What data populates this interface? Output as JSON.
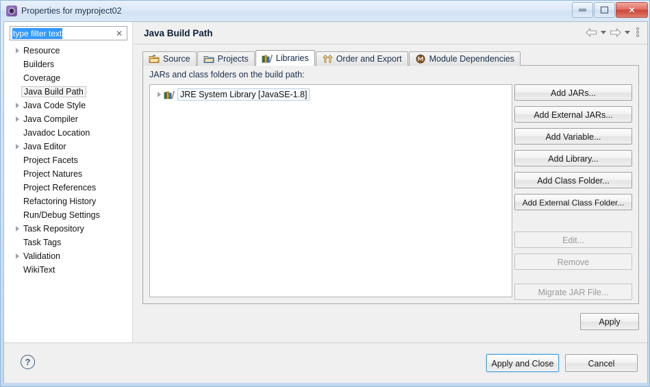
{
  "window": {
    "title": "Properties for myproject02",
    "app_icon": "eclipse-gear-icon",
    "minimize_label": "Minimize",
    "restore_label": "Restore",
    "close_label": "Close",
    "close_glyph": "✕"
  },
  "sidebar": {
    "filter": {
      "value": "type filter text",
      "placeholder": "type filter text",
      "clear_glyph": "✕"
    },
    "items": [
      {
        "label": "Resource",
        "expandable": true,
        "selected": false
      },
      {
        "label": "Builders",
        "expandable": false,
        "selected": false
      },
      {
        "label": "Coverage",
        "expandable": false,
        "selected": false
      },
      {
        "label": "Java Build Path",
        "expandable": false,
        "selected": true
      },
      {
        "label": "Java Code Style",
        "expandable": true,
        "selected": false
      },
      {
        "label": "Java Compiler",
        "expandable": true,
        "selected": false
      },
      {
        "label": "Javadoc Location",
        "expandable": false,
        "selected": false
      },
      {
        "label": "Java Editor",
        "expandable": true,
        "selected": false
      },
      {
        "label": "Project Facets",
        "expandable": false,
        "selected": false
      },
      {
        "label": "Project Natures",
        "expandable": false,
        "selected": false
      },
      {
        "label": "Project References",
        "expandable": false,
        "selected": false
      },
      {
        "label": "Refactoring History",
        "expandable": false,
        "selected": false
      },
      {
        "label": "Run/Debug Settings",
        "expandable": false,
        "selected": false
      },
      {
        "label": "Task Repository",
        "expandable": true,
        "selected": false
      },
      {
        "label": "Task Tags",
        "expandable": false,
        "selected": false
      },
      {
        "label": "Validation",
        "expandable": true,
        "selected": false
      },
      {
        "label": "WikiText",
        "expandable": false,
        "selected": false
      }
    ]
  },
  "content": {
    "page_title": "Java Build Path",
    "nav": {
      "back_icon": "back-arrow-icon",
      "back_menu_icon": "chevron-down-icon",
      "forward_icon": "forward-arrow-icon",
      "forward_menu_icon": "chevron-down-icon",
      "more_icon": "vertical-dots-icon"
    },
    "tabs": [
      {
        "label": "Source",
        "icon": "source-folder-icon",
        "active": false
      },
      {
        "label": "Projects",
        "icon": "projects-folder-icon",
        "active": false
      },
      {
        "label": "Libraries",
        "icon": "libraries-books-icon",
        "active": true
      },
      {
        "label": "Order and Export",
        "icon": "order-export-arrows-icon",
        "active": false
      },
      {
        "label": "Module Dependencies",
        "icon": "module-circle-icon",
        "active": false
      }
    ],
    "panel": {
      "caption": "JARs and class folders on the build path:",
      "entries": [
        {
          "label": "JRE System Library [JavaSE-1.8]",
          "icon": "jre-library-icon",
          "expandable": true,
          "focused": true
        }
      ]
    },
    "side_buttons": [
      {
        "label": "Add JARs...",
        "enabled": true
      },
      {
        "label": "Add External JARs...",
        "enabled": true
      },
      {
        "label": "Add Variable...",
        "enabled": true
      },
      {
        "label": "Add Library...",
        "enabled": true
      },
      {
        "label": "Add Class Folder...",
        "enabled": true
      },
      {
        "label": "Add External Class Folder...",
        "enabled": true
      },
      {
        "label": "Edit...",
        "enabled": false
      },
      {
        "label": "Remove",
        "enabled": false
      },
      {
        "label": "Migrate JAR File...",
        "enabled": false
      }
    ],
    "apply_label": "Apply"
  },
  "footer": {
    "help_glyph": "?",
    "apply_and_close_label": "Apply and Close",
    "cancel_label": "Cancel"
  },
  "colors": {
    "accent_blue": "#3399ff",
    "focus_blue": "#3c9bd4",
    "dialog_bg": "#f0f0f0",
    "close_red": "#cd4437"
  }
}
